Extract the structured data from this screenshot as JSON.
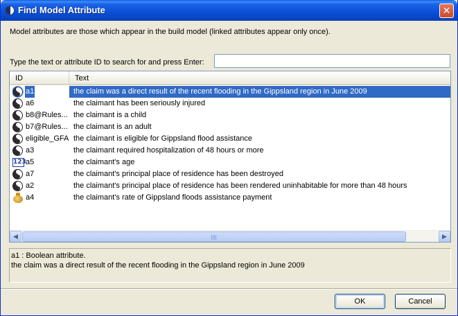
{
  "window": {
    "title": "Find Model Attribute",
    "close_glyph": "✕"
  },
  "description": "Model attributes are those which appear in the build model (linked attributes appear only once).",
  "search": {
    "label": "Type the text or attribute ID to search for and press Enter:",
    "value": ""
  },
  "list": {
    "columns": [
      "ID",
      "Text"
    ],
    "rows": [
      {
        "icon": "boolean-icon",
        "id": "a1",
        "text": "the claim was a direct result of the recent flooding in the Gippsland region in June 2009",
        "selected": true
      },
      {
        "icon": "boolean-icon",
        "id": "a6",
        "text": "the claimant has been seriously injured"
      },
      {
        "icon": "boolean-icon",
        "id": "b8@Rules...",
        "text": "the claimant is a child"
      },
      {
        "icon": "boolean-icon",
        "id": "b7@Rules...",
        "text": "the claimant is an adult"
      },
      {
        "icon": "boolean-icon",
        "id": "eligible_GFA",
        "text": "the claimant is eligible for Gippsland flood assistance"
      },
      {
        "icon": "boolean-icon",
        "id": "a3",
        "text": "the claimant required hospitalization of 48 hours or more"
      },
      {
        "icon": "number-icon",
        "id": "a5",
        "text": "the claimant's age"
      },
      {
        "icon": "boolean-icon",
        "id": "a7",
        "text": "the claimant's principal place of residence has been destroyed"
      },
      {
        "icon": "boolean-icon",
        "id": "a2",
        "text": "the claimant's principal place of residence has been rendered uninhabitable for more than 48 hours"
      },
      {
        "icon": "currency-icon",
        "id": "a4",
        "text": "the claimant's rate of Gippsland floods assistance payment"
      }
    ],
    "number_icon_glyph": "123"
  },
  "info": {
    "line1": "a1 : Boolean attribute.",
    "line2": "the claim was a direct result of the recent flooding in the Gippsland region in June 2009"
  },
  "buttons": {
    "ok": "OK",
    "cancel": "Cancel"
  },
  "scroll": {
    "left_glyph": "◀",
    "right_glyph": "▶"
  }
}
